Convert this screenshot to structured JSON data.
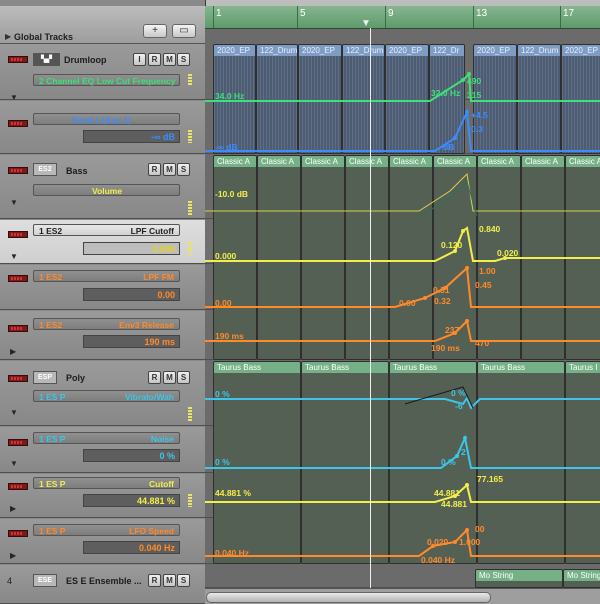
{
  "colors": {
    "green": "#3ee07a",
    "blue": "#3a8cff",
    "yellow": "#f2ee4a",
    "orange": "#ff8a2a",
    "cyan": "#3cc6e8",
    "region_audio": "#7f9cc4",
    "region_midi": "#76b087"
  },
  "global_tracks": {
    "label": "Global Tracks",
    "add_icon": "plus-icon",
    "view_icon": "tracks-view-icon"
  },
  "ruler": {
    "bars": [
      "1",
      "5",
      "9",
      "13",
      "17"
    ]
  },
  "tracks": [
    {
      "id": "drumloop",
      "name": "Drumloop",
      "buttons": [
        "I",
        "R",
        "M",
        "S"
      ],
      "param": "2 Channel EQ Low Cut Frequency",
      "param_color": "#3ee07a"
    },
    {
      "id": "send",
      "param": "Send 1 (Aux 1)",
      "value": "-∞ dB",
      "param_color": "#3a8cff"
    },
    {
      "id": "bass",
      "inst": "ES2",
      "name": "Bass",
      "buttons": [
        "R",
        "M",
        "S"
      ],
      "param": "Volume",
      "param_color": "#f2ee4a"
    },
    {
      "id": "es2-lpf",
      "label": "1 ES2",
      "param": "LPF Cutoff",
      "value": "0.000",
      "param_color": "#f2ee4a"
    },
    {
      "id": "es2-lpffm",
      "label": "1 ES2",
      "param": "LPF FM",
      "value": "0.00",
      "param_color": "#ff8a2a"
    },
    {
      "id": "es2-env",
      "label": "1 ES2",
      "param": "Env3 Release",
      "value": "190 ms",
      "param_color": "#ff8a2a"
    },
    {
      "id": "poly",
      "inst": "ESP",
      "name": "Poly",
      "buttons": [
        "R",
        "M",
        "S"
      ],
      "label": "1 ES P",
      "param": "Vibrato/Wah",
      "param_color": "#3cc6e8"
    },
    {
      "id": "esp-noise",
      "label": "1 ES P",
      "param": "Noise",
      "value": "0 %",
      "param_color": "#3cc6e8"
    },
    {
      "id": "esp-cutoff",
      "label": "1 ES P",
      "param": "Cutoff",
      "value": "44.881 %",
      "param_color": "#f2ee4a"
    },
    {
      "id": "esp-lfo",
      "label": "1 ES P",
      "param": "LFO Speed",
      "value": "0.040 Hz",
      "param_color": "#ff8a2a"
    },
    {
      "id": "ensemble",
      "num": "4",
      "inst": "ESE",
      "name": "ES E Ensemble ...",
      "buttons": [
        "R",
        "M",
        "S"
      ]
    }
  ],
  "regions": {
    "drum": [
      "2020_EP",
      "122_Drum",
      "2020_EP",
      "122_Drum",
      "2020_EP",
      "122_Dr",
      "2020_EP",
      "122_Drum",
      "2020_EP"
    ],
    "bass": [
      "Classic A",
      "Classic A",
      "Classic A",
      "Classic A",
      "Classic A",
      "Classic A",
      "Classic A",
      "Classic A",
      "Classic A"
    ],
    "poly": [
      "Taurus Bass",
      "Taurus Bass",
      "Taurus Bass",
      "Taurus Bass",
      "Taurus I"
    ],
    "ensemble": [
      "Mo String",
      "Mo String"
    ]
  },
  "automation": {
    "eq": {
      "left": "34.0 Hz",
      "mid": "32.0 Hz",
      "peak": "490",
      "low": "315"
    },
    "send": {
      "left": "-∞ dB",
      "mid": "dB",
      "peak": "+4.5",
      "low": "0.3"
    },
    "vol": {
      "left": "-10.0 dB"
    },
    "lpf": {
      "left": "0.000",
      "mid": "0.120",
      "peak": "0.840",
      "right": "0.020"
    },
    "lpffm": {
      "left": "0.00",
      "a": "0.00",
      "b": "0.31",
      "c": "0.32",
      "peak": "1.00",
      "d": "0.45"
    },
    "env": {
      "left": "190 ms",
      "a": "190 ms",
      "b": "470",
      "c": "237"
    },
    "vib": {
      "left": "0 %",
      "a": "0 %",
      "b": "-6"
    },
    "noise": {
      "left": "0 %",
      "a": "0 %",
      "b": "2"
    },
    "cutoff": {
      "left": "44.881 %",
      "a": "44.881",
      "b": "77.165",
      "c": "44.881"
    },
    "lfo": {
      "left": "0.040 Hz",
      "a": "0.040 Hz",
      "b": "0.020",
      "c": "1.000",
      "d": "00"
    }
  }
}
